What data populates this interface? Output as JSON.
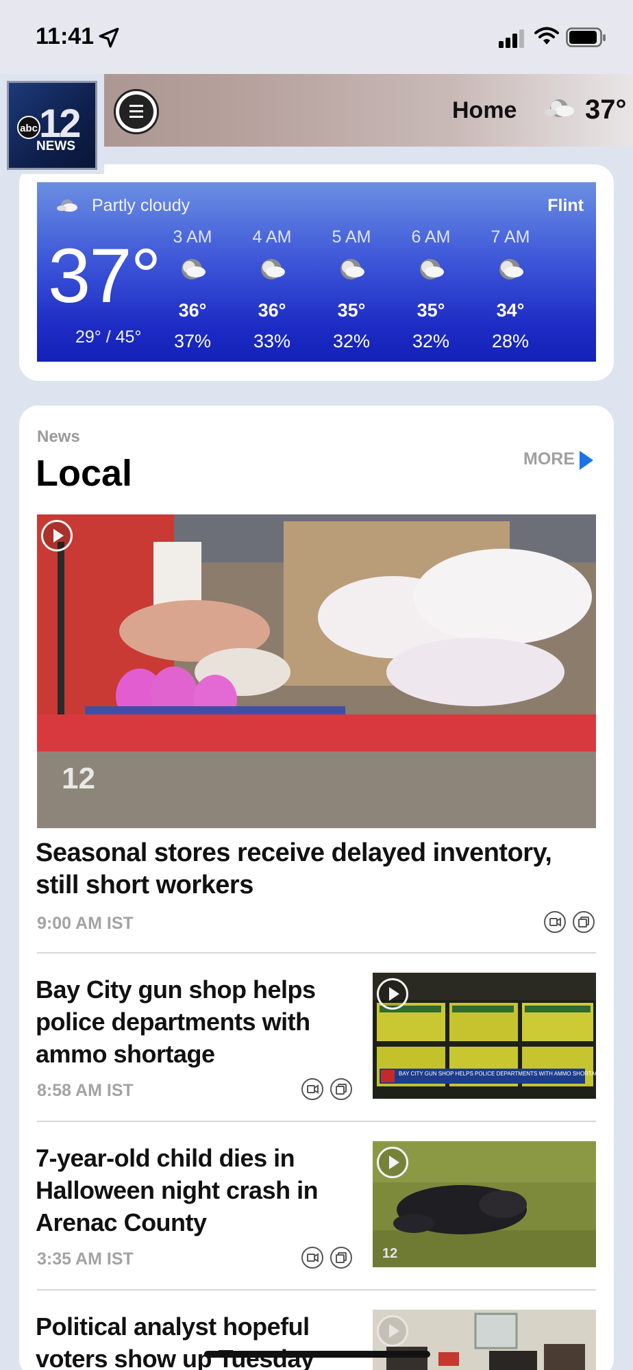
{
  "status_bar": {
    "time": "11:41"
  },
  "header": {
    "logo_abc": "abc",
    "logo_number": "12",
    "logo_news": "NEWS",
    "nav_label": "Home",
    "temperature": "37°",
    "weather_icon": "partly-cloudy-icon"
  },
  "weather": {
    "condition": "Partly cloudy",
    "city": "Flint",
    "current_temp": "37°",
    "range": "29° / 45°",
    "panel_gradient": [
      "#6b8fe2",
      "#1321b8"
    ],
    "hours": [
      {
        "time": "3 AM",
        "temp": "36°",
        "precip": "37%"
      },
      {
        "time": "4 AM",
        "temp": "36°",
        "precip": "33%"
      },
      {
        "time": "5 AM",
        "temp": "35°",
        "precip": "32%"
      },
      {
        "time": "6 AM",
        "temp": "35°",
        "precip": "32%"
      },
      {
        "time": "7 AM",
        "temp": "34°",
        "precip": "28%"
      }
    ]
  },
  "news": {
    "eyebrow": "News",
    "title": "Local",
    "more_label": "MORE",
    "accent_color": "#1a73e8",
    "hero": {
      "headline": "Seasonal stores receive delayed inventory, still short workers",
      "timestamp": "9:00 AM IST"
    },
    "stories": [
      {
        "headline": "Bay City gun shop helps police departments with ammo shortage",
        "timestamp": "8:58 AM IST",
        "thumb_caption": "BAY CITY GUN SHOP HELPS POLICE DEPARTMENTS WITH AMMO SHORTAGE"
      },
      {
        "headline": "7-year-old child dies in Halloween night crash in Arenac County",
        "timestamp": "3:35 AM IST"
      },
      {
        "headline": "Political analyst hopeful voters show up Tuesday to"
      }
    ]
  }
}
